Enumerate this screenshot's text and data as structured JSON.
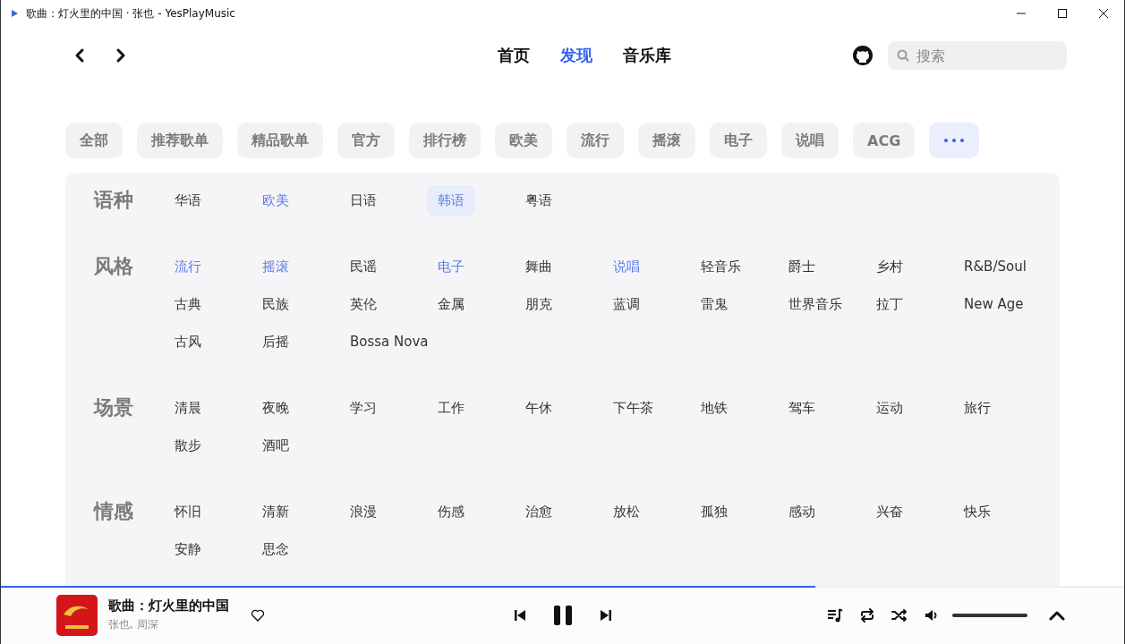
{
  "window": {
    "title": "歌曲：灯火里的中国 · 张也 - YesPlayMusic"
  },
  "nav": [
    {
      "label": "首页",
      "selected": false
    },
    {
      "label": "发现",
      "selected": true
    },
    {
      "label": "音乐库",
      "selected": false
    }
  ],
  "search": {
    "placeholder": "搜索"
  },
  "chips": [
    {
      "label": "全部",
      "kind": "text"
    },
    {
      "label": "推荐歌单",
      "kind": "text"
    },
    {
      "label": "精品歌单",
      "kind": "text"
    },
    {
      "label": "官方",
      "kind": "text"
    },
    {
      "label": "排行榜",
      "kind": "text"
    },
    {
      "label": "欧美",
      "kind": "text"
    },
    {
      "label": "流行",
      "kind": "text"
    },
    {
      "label": "摇滚",
      "kind": "text"
    },
    {
      "label": "电子",
      "kind": "text"
    },
    {
      "label": "说唱",
      "kind": "text"
    },
    {
      "label": "ACG",
      "kind": "text"
    },
    {
      "kind": "more"
    }
  ],
  "sections": [
    {
      "title": "语种",
      "items": [
        {
          "label": "华语",
          "selected": false,
          "hovered": false
        },
        {
          "label": "欧美",
          "selected": true,
          "hovered": false
        },
        {
          "label": "日语",
          "selected": false,
          "hovered": false
        },
        {
          "label": "韩语",
          "selected": true,
          "hovered": true
        },
        {
          "label": "粤语",
          "selected": false,
          "hovered": false
        }
      ]
    },
    {
      "title": "风格",
      "items": [
        {
          "label": "流行",
          "selected": true,
          "hovered": false
        },
        {
          "label": "摇滚",
          "selected": true,
          "hovered": false
        },
        {
          "label": "民谣",
          "selected": false,
          "hovered": false
        },
        {
          "label": "电子",
          "selected": true,
          "hovered": false
        },
        {
          "label": "舞曲",
          "selected": false,
          "hovered": false
        },
        {
          "label": "说唱",
          "selected": true,
          "hovered": false
        },
        {
          "label": "轻音乐",
          "selected": false,
          "hovered": false
        },
        {
          "label": "爵士",
          "selected": false,
          "hovered": false
        },
        {
          "label": "乡村",
          "selected": false,
          "hovered": false
        },
        {
          "label": "R&B/Soul",
          "selected": false,
          "hovered": false
        },
        {
          "label": "古典",
          "selected": false,
          "hovered": false
        },
        {
          "label": "民族",
          "selected": false,
          "hovered": false
        },
        {
          "label": "英伦",
          "selected": false,
          "hovered": false
        },
        {
          "label": "金属",
          "selected": false,
          "hovered": false
        },
        {
          "label": "朋克",
          "selected": false,
          "hovered": false
        },
        {
          "label": "蓝调",
          "selected": false,
          "hovered": false
        },
        {
          "label": "雷鬼",
          "selected": false,
          "hovered": false
        },
        {
          "label": "世界音乐",
          "selected": false,
          "hovered": false
        },
        {
          "label": "拉丁",
          "selected": false,
          "hovered": false
        },
        {
          "label": "New Age",
          "selected": false,
          "hovered": false
        },
        {
          "label": "古风",
          "selected": false,
          "hovered": false
        },
        {
          "label": "后摇",
          "selected": false,
          "hovered": false
        },
        {
          "label": "Bossa Nova",
          "selected": false,
          "hovered": false
        }
      ]
    },
    {
      "title": "场景",
      "items": [
        {
          "label": "清晨",
          "selected": false,
          "hovered": false
        },
        {
          "label": "夜晚",
          "selected": false,
          "hovered": false
        },
        {
          "label": "学习",
          "selected": false,
          "hovered": false
        },
        {
          "label": "工作",
          "selected": false,
          "hovered": false
        },
        {
          "label": "午休",
          "selected": false,
          "hovered": false
        },
        {
          "label": "下午茶",
          "selected": false,
          "hovered": false
        },
        {
          "label": "地铁",
          "selected": false,
          "hovered": false
        },
        {
          "label": "驾车",
          "selected": false,
          "hovered": false
        },
        {
          "label": "运动",
          "selected": false,
          "hovered": false
        },
        {
          "label": "旅行",
          "selected": false,
          "hovered": false
        },
        {
          "label": "散步",
          "selected": false,
          "hovered": false
        },
        {
          "label": "酒吧",
          "selected": false,
          "hovered": false
        }
      ]
    },
    {
      "title": "情感",
      "items": [
        {
          "label": "怀旧",
          "selected": false,
          "hovered": false
        },
        {
          "label": "清新",
          "selected": false,
          "hovered": false
        },
        {
          "label": "浪漫",
          "selected": false,
          "hovered": false
        },
        {
          "label": "伤感",
          "selected": false,
          "hovered": false
        },
        {
          "label": "治愈",
          "selected": false,
          "hovered": false
        },
        {
          "label": "放松",
          "selected": false,
          "hovered": false
        },
        {
          "label": "孤独",
          "selected": false,
          "hovered": false
        },
        {
          "label": "感动",
          "selected": false,
          "hovered": false
        },
        {
          "label": "兴奋",
          "selected": false,
          "hovered": false
        },
        {
          "label": "快乐",
          "selected": false,
          "hovered": false
        },
        {
          "label": "安静",
          "selected": false,
          "hovered": false
        },
        {
          "label": "思念",
          "selected": false,
          "hovered": false
        }
      ]
    }
  ],
  "player": {
    "progress": {
      "level": 0.725
    },
    "title": "歌曲：灯火里的中国",
    "artists": "张也, 周深",
    "liked": false,
    "playing": true,
    "volume": {
      "level": 1
    }
  }
}
